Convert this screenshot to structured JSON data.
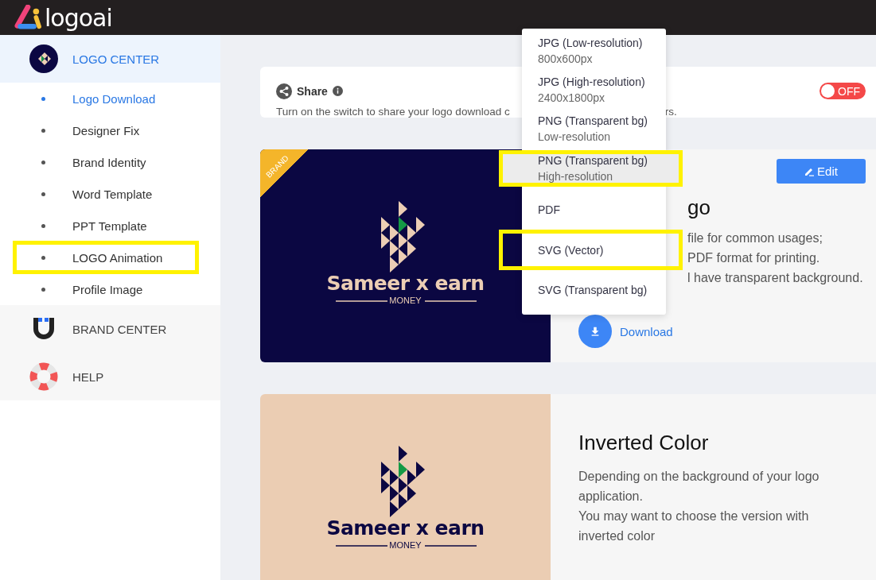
{
  "header": {
    "logo": "logoai"
  },
  "sidebar": {
    "sections": [
      {
        "kind": "logo",
        "label": "LOGO CENTER",
        "selected": true,
        "children": [
          {
            "label": "Logo Download",
            "selected": true,
            "highlighted": false
          },
          {
            "label": "Designer Fix",
            "selected": false,
            "highlighted": false
          },
          {
            "label": "Brand Identity",
            "selected": false,
            "highlighted": false
          },
          {
            "label": "Word Template",
            "selected": false,
            "highlighted": false
          },
          {
            "label": "PPT Template",
            "selected": false,
            "highlighted": false
          },
          {
            "label": "LOGO Animation",
            "selected": false,
            "highlighted": true
          },
          {
            "label": "Profile Image",
            "selected": false,
            "highlighted": false
          }
        ]
      },
      {
        "kind": "brand",
        "label": "BRAND CENTER",
        "selected": false
      },
      {
        "kind": "help",
        "label": "HELP",
        "selected": false
      }
    ]
  },
  "share": {
    "title": "Share",
    "on": false,
    "toggle_label": "OFF",
    "text_left": "Turn on the switch to share your logo download c",
    "text_right": "rs."
  },
  "cards": [
    {
      "kind": "dark",
      "badge": "BRAND",
      "brand_name": "Sameer x earn",
      "tagline": "MONEY",
      "title": "go",
      "lines": [
        "file for common usages;",
        "PDF format for printing.",
        "l have transparent background."
      ],
      "edit": "Edit",
      "download": "Download"
    },
    {
      "kind": "light",
      "brand_name": "Sameer x earn",
      "tagline": "MONEY",
      "title": "Inverted Color",
      "lines": [
        "Depending on the background of your logo application.",
        "You may want to choose the version with inverted color"
      ]
    }
  ],
  "download_menu": [
    {
      "label": "JPG (Low-resolution)",
      "detail": "800x600px",
      "hovered": false,
      "highlighted": false
    },
    {
      "label": "JPG (High-resolution)",
      "detail": "2400x1800px",
      "hovered": false,
      "highlighted": false
    },
    {
      "label": "PNG (Transparent bg)",
      "detail": "Low-resolution",
      "hovered": false,
      "highlighted": false
    },
    {
      "label": "PNG (Transparent bg)",
      "detail": "High-resolution",
      "hovered": true,
      "highlighted": true
    },
    {
      "label": "PDF",
      "hovered": false,
      "highlighted": false
    },
    {
      "label": "SVG (Vector)",
      "hovered": false,
      "highlighted": true
    },
    {
      "label": "SVG (Transparent bg)",
      "hovered": false,
      "highlighted": false
    }
  ]
}
